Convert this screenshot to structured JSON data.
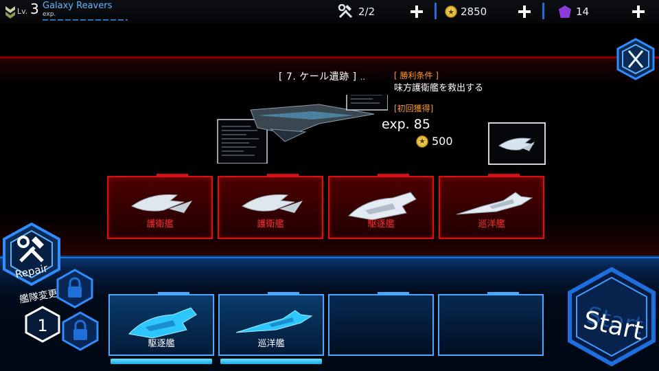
{
  "header": {
    "level_label": "Lv.",
    "level": "3",
    "player_name": "Galaxy Reavers",
    "exp_label": "exp.",
    "repair_count": "2/2",
    "coins": "2850",
    "gems": "14"
  },
  "mission": {
    "title": "[ 7. ケール遺跡 ]",
    "title_suffix": "‥",
    "condition_heading": "[ 勝利条件 ]",
    "condition_text": "味方護衛艦を救出する",
    "first_reward_heading": "[初回獲得]",
    "reward_exp": "exp.  85",
    "reward_coins": "500"
  },
  "enemy_fleet": [
    {
      "label": "護衛艦",
      "icon": "escort-ship-icon"
    },
    {
      "label": "護衛艦",
      "icon": "escort-ship-icon"
    },
    {
      "label": "駆逐艦",
      "icon": "destroyer-ship-icon"
    },
    {
      "label": "巡洋艦",
      "icon": "cruiser-ship-icon"
    }
  ],
  "player_fleet": [
    {
      "label": "駆逐艦",
      "icon": "destroyer-ship-icon",
      "hp": 1.0
    },
    {
      "label": "巡洋艦",
      "icon": "cruiser-ship-icon",
      "hp": 1.0
    },
    {
      "label": "",
      "icon": ""
    },
    {
      "label": "",
      "icon": ""
    }
  ],
  "controls": {
    "repair_label": "Repair",
    "fleet_change_label": "艦隊変更",
    "fleet_number": "1",
    "start_label": "Start"
  },
  "colors": {
    "enemy_accent": "#d81010",
    "player_accent": "#4aa8ff",
    "highlight_orange": "#ff9a22",
    "name_blue": "#5fb9ff"
  }
}
